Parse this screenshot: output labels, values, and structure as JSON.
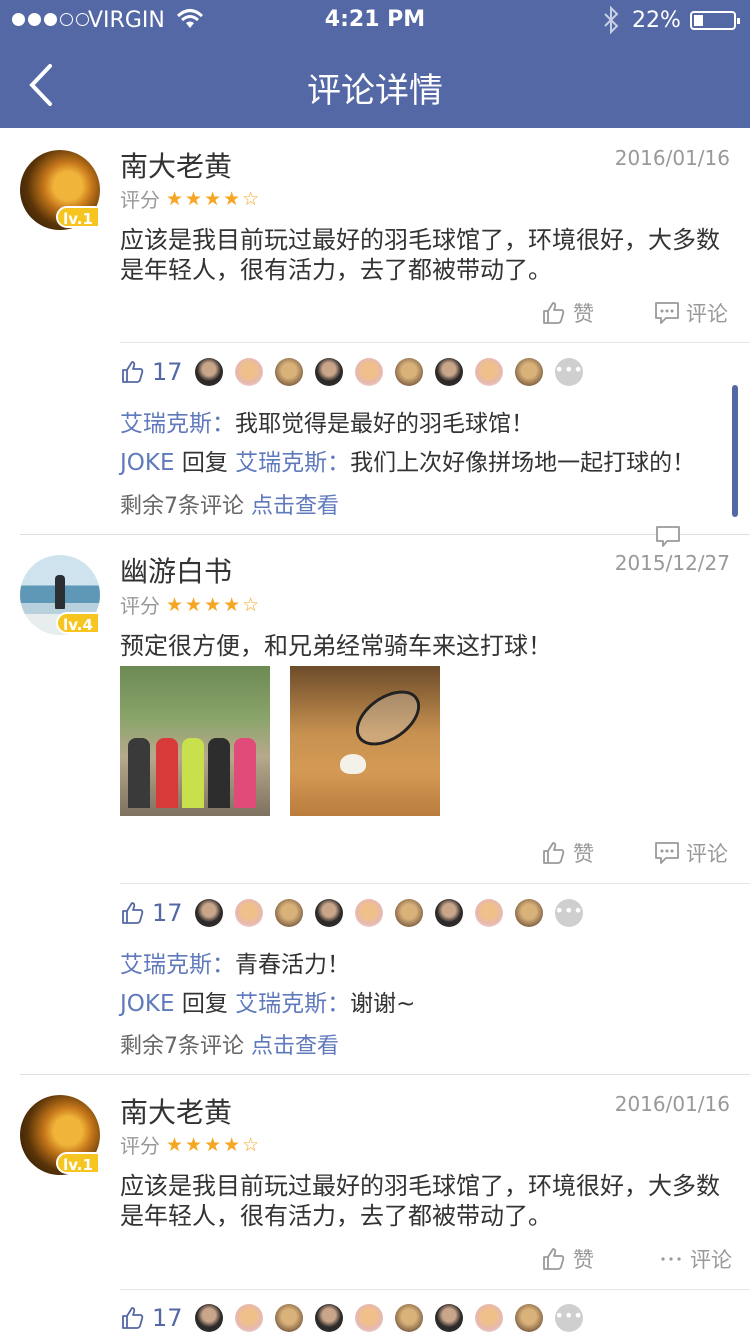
{
  "status_bar": {
    "carrier": "VIRGIN",
    "time": "4:21 PM",
    "battery": "22%"
  },
  "header": {
    "title": "评论详情"
  },
  "labels": {
    "rating": "评分",
    "like": "赞",
    "comment": "评论",
    "reply_word": "回复",
    "remaining": "剩余7条评论",
    "view": "点击查看"
  },
  "reviews": [
    {
      "user": "南大老黄",
      "level": "lv.1",
      "date": "2016/01/16",
      "stars": "★★★★☆",
      "text": "应该是我目前玩过最好的羽毛球馆了，环境很好，大多数是年轻人，很有活力，去了都被带动了。",
      "like_count": "17",
      "replies": [
        {
          "from": "艾瑞克斯",
          "sep": "：",
          "text": "我耶觉得是最好的羽毛球馆！"
        },
        {
          "from": "JOKE",
          "to": "艾瑞克斯",
          "sep": "：",
          "text": "我们上次好像拼场地一起打球的！"
        }
      ]
    },
    {
      "user": "幽游白书",
      "level": "lv.4",
      "date": "2015/12/27",
      "stars": "★★★★☆",
      "text": "预定很方便，和兄弟经常骑车来这打球！",
      "like_count": "17",
      "replies": [
        {
          "from": "艾瑞克斯",
          "sep": "：",
          "text": "青春活力！"
        },
        {
          "from": "JOKE",
          "to": "艾瑞克斯",
          "sep": "：",
          "text": "谢谢~"
        }
      ]
    },
    {
      "user": "南大老黄",
      "level": "lv.1",
      "date": "2016/01/16",
      "stars": "★★★★☆",
      "text": "应该是我目前玩过最好的羽毛球馆了，环境很好，大多数是年轻人，很有活力，去了都被带动了。",
      "like_count": "17"
    }
  ],
  "colors": {
    "primary": "#5468a6",
    "link": "#5f79bd",
    "star": "#f5a623",
    "level_badge": "#f7c51f"
  },
  "icons": [
    "signal-icon",
    "wifi-icon",
    "bluetooth-icon",
    "battery-icon",
    "back-chevron-icon",
    "thumbs-up-icon",
    "comment-icon",
    "more-icon"
  ]
}
